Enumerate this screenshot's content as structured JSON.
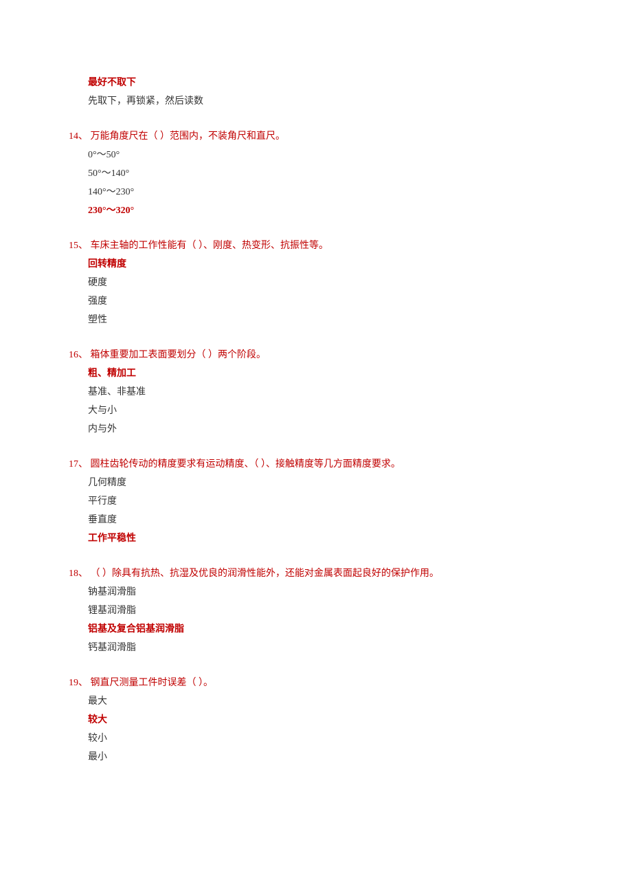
{
  "questions": [
    {
      "num": "",
      "text": "",
      "options": [
        {
          "text": "最好不取下",
          "correct": true
        },
        {
          "text": "先取下，再锁紧，然后读数",
          "correct": false
        }
      ]
    },
    {
      "num": "14、",
      "text": " 万能角度尺在（ ）范围内，不装角尺和直尺。",
      "options": [
        {
          "text": "0°～50°",
          "correct": false
        },
        {
          "text": "50°～140°",
          "correct": false
        },
        {
          "text": "140°～230°",
          "correct": false
        },
        {
          "text": "230°～320°",
          "correct": true
        }
      ]
    },
    {
      "num": "15、",
      "text": " 车床主轴的工作性能有（ ）、刚度、热变形、抗振性等。",
      "options": [
        {
          "text": "回转精度",
          "correct": true
        },
        {
          "text": "硬度",
          "correct": false
        },
        {
          "text": "强度",
          "correct": false
        },
        {
          "text": "塑性",
          "correct": false
        }
      ]
    },
    {
      "num": "16、",
      "text": " 箱体重要加工表面要划分（ ）两个阶段。",
      "options": [
        {
          "text": "粗、精加工",
          "correct": true
        },
        {
          "text": "基准、非基准",
          "correct": false
        },
        {
          "text": "大与小",
          "correct": false
        },
        {
          "text": "内与外",
          "correct": false
        }
      ]
    },
    {
      "num": "17、",
      "text": " 圆柱齿轮传动的精度要求有运动精度、（ ）、接触精度等几方面精度要求。",
      "options": [
        {
          "text": "几何精度",
          "correct": false
        },
        {
          "text": "平行度",
          "correct": false
        },
        {
          "text": "垂直度",
          "correct": false
        },
        {
          "text": "工作平稳性",
          "correct": true
        }
      ]
    },
    {
      "num": "18、",
      "text": " （ ）除具有抗热、抗湿及优良的润滑性能外，还能对金属表面起良好的保护作用。",
      "options": [
        {
          "text": "钠基润滑脂",
          "correct": false
        },
        {
          "text": "锂基润滑脂",
          "correct": false
        },
        {
          "text": "铝基及复合铝基润滑脂",
          "correct": true
        },
        {
          "text": "钙基润滑脂",
          "correct": false
        }
      ]
    },
    {
      "num": "19、",
      "text": " 钢直尺测量工件时误差（ ）。",
      "options": [
        {
          "text": "最大",
          "correct": false
        },
        {
          "text": "较大",
          "correct": true
        },
        {
          "text": "较小",
          "correct": false
        },
        {
          "text": "最小",
          "correct": false
        }
      ]
    }
  ]
}
